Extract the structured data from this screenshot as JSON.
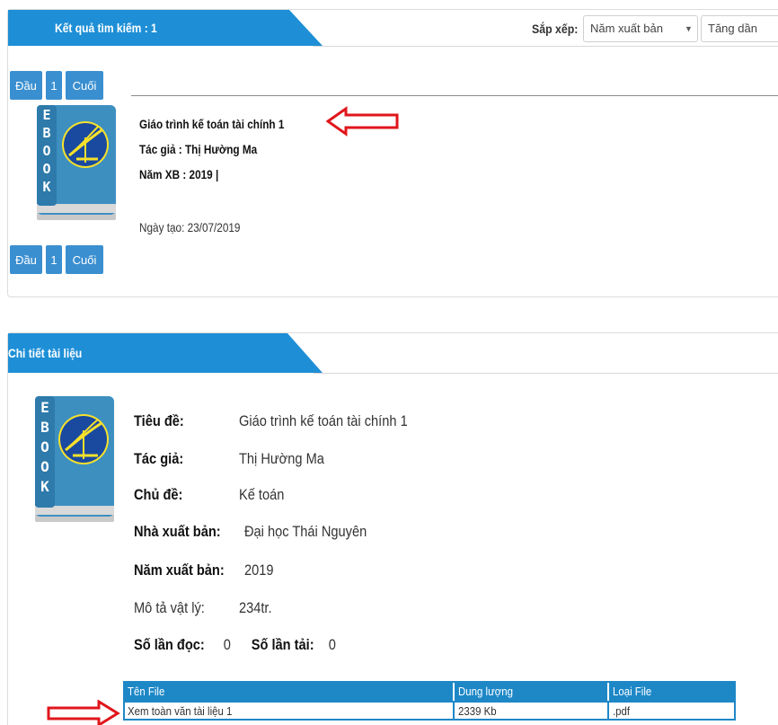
{
  "search_panel": {
    "tab_title": "Kết quả tìm kiếm : 1",
    "sort_label": "Sắp xếp:",
    "sort_field": "Năm xuất bản",
    "sort_order": "Tăng dần",
    "pager": {
      "first": "Đầu",
      "page": "1",
      "last": "Cuối"
    },
    "result": {
      "title": "Giáo trình kế toán tài chính 1",
      "author": "Tác giả : Thị Hường Ma",
      "year": "Năm XB : 2019 |",
      "created": "Ngày tạo: 23/07/2019",
      "cover_icon": "ebook-cover-icon"
    }
  },
  "detail_panel": {
    "tab_title": "Chi tiết tài liệu",
    "fields": {
      "title_label": "Tiêu đề:",
      "title_value": "Giáo trình kế toán tài chính 1",
      "author_label": "Tác giả:",
      "author_value": "Thị Hường Ma",
      "subject_label": "Chủ đề:",
      "subject_value": "Kế toán",
      "publisher_label": "Nhà xuất bản:",
      "publisher_value": "Đại học Thái Nguyên",
      "year_label": "Năm xuất bản:",
      "year_value": "2019",
      "physical_label": "Mô tả vật lý:",
      "physical_value": "234tr.",
      "reads_label": "Số lần đọc:",
      "reads_value": "0",
      "downloads_label": "Số lần tải:",
      "downloads_value": "0"
    },
    "files": {
      "headers": [
        "Tên File",
        "Dung lượng",
        "Loại File"
      ],
      "rows": [
        {
          "name": "Xem toàn văn tài liệu 1",
          "size": "2339 Kb",
          "type": ".pdf"
        }
      ]
    }
  },
  "colors": {
    "accent": "#1e8fd6",
    "arrow": "#e0161b",
    "button": "#3a8fd0"
  },
  "annotations": [
    "red-arrow-icon",
    "red-arrow-icon"
  ]
}
